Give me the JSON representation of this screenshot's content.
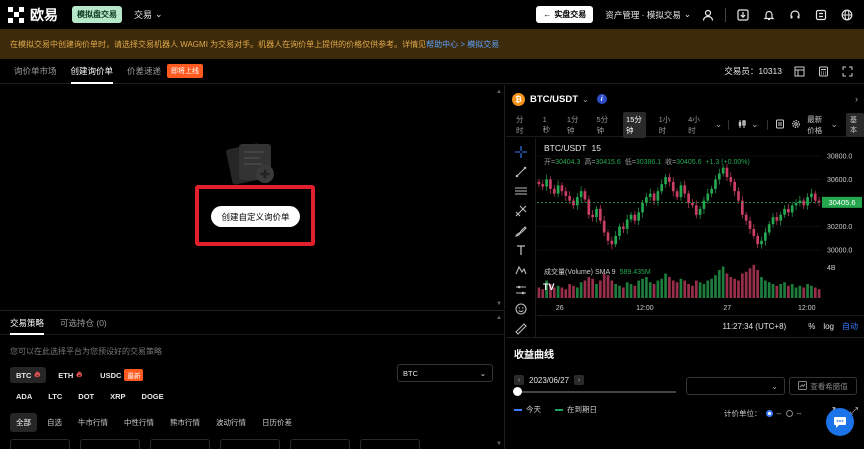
{
  "nav": {
    "logo_text": "欧易",
    "demo_badge": "模拟盘交易",
    "trade_menu": "交易",
    "real_trade_button": "实盘交易",
    "asset_menu": "资产管理 · 模拟交易"
  },
  "banner": {
    "text": "在模拟交易中创建询价单时，请选择交易机器人 WAGMI 为交易对手。机器人在询价单上提供的价格仅供参考。详情见",
    "link_text": "帮助中心 > 模拟交易"
  },
  "subtabs": {
    "items": [
      {
        "label": "询价单市场",
        "active": false
      },
      {
        "label": "创建询价单",
        "active": true
      },
      {
        "label": "价差速递",
        "active": false
      }
    ],
    "soon_badge": "即将上线",
    "trader_label": "交易员：",
    "trader_id": "10313"
  },
  "main": {
    "create_button": "创建自定义询价单"
  },
  "strategy": {
    "tabs": [
      {
        "label": "交易策略",
        "active": true
      },
      {
        "label": "可选持仓 (0)",
        "active": false
      }
    ],
    "hint": "您可以在此选择平台为您预设好的交易策略",
    "coins_row1": [
      {
        "label": "BTC",
        "active": true,
        "hot": true
      },
      {
        "label": "ETH",
        "active": false,
        "hot": true
      },
      {
        "label": "USDC",
        "active": false,
        "hot": false,
        "badge": "最新"
      }
    ],
    "pair_select": "BTC",
    "coins_row2": [
      "ADA",
      "LTC",
      "DOT",
      "XRP",
      "DOGE"
    ],
    "filters": [
      {
        "label": "全部",
        "active": true
      },
      {
        "label": "自选",
        "active": false
      },
      {
        "label": "牛市行情",
        "active": false
      },
      {
        "label": "中性行情",
        "active": false
      },
      {
        "label": "熊市行情",
        "active": false
      },
      {
        "label": "波动行情",
        "active": false
      },
      {
        "label": "日历价差",
        "active": false
      }
    ]
  },
  "chart": {
    "pair": "BTC/USDT",
    "intervals": [
      {
        "label": "分时",
        "active": false
      },
      {
        "label": "1秒",
        "active": false
      },
      {
        "label": "1分钟",
        "active": false
      },
      {
        "label": "5分钟",
        "active": false
      },
      {
        "label": "15分钟",
        "active": true
      },
      {
        "label": "1小时",
        "active": false
      },
      {
        "label": "4小时",
        "active": false
      }
    ],
    "latest_price_label": "最新价格",
    "more_label": "基本",
    "footer_time": "11:27:34 (UTC+8)",
    "footer_opts": [
      {
        "label": "%",
        "active": false
      },
      {
        "label": "log",
        "active": false
      },
      {
        "label": "自动",
        "active": true
      }
    ]
  },
  "chart_data": {
    "type": "candlestick",
    "title": "BTC/USDT · 15",
    "ohlc_label": {
      "open_label": "开=",
      "open": "30404.3",
      "high_label": "高=",
      "high": "30415.6",
      "low_label": "低=",
      "low": "30386.1",
      "close_label": "收=",
      "close": "30405.6",
      "change": "+1.3 (+0.00%)"
    },
    "interval_label": "15",
    "current_price": "30405.6",
    "y_ticks": [
      "30800.0",
      "30600.0",
      "30400.0",
      "30200.0",
      "30000.0"
    ],
    "ylim": [
      29950,
      30850
    ],
    "x_ticks": [
      "26",
      "12:00",
      "27",
      "12:00"
    ],
    "volume_label": "成交量(Volume) SMA 9",
    "volume_sma": "589.435M",
    "volume_tick": "4B",
    "closes": [
      30560,
      30540,
      30600,
      30520,
      30480,
      30550,
      30500,
      30460,
      30420,
      30380,
      30450,
      30500,
      30430,
      30300,
      30280,
      30350,
      30250,
      30150,
      30080,
      30050,
      30120,
      30200,
      30180,
      30260,
      30300,
      30250,
      30320,
      30400,
      30450,
      30480,
      30420,
      30500,
      30560,
      30620,
      30580,
      30500,
      30450,
      30550,
      30480,
      30400,
      30380,
      30300,
      30350,
      30420,
      30480,
      30520,
      30600,
      30650,
      30700,
      30620,
      30580,
      30500,
      30420,
      30300,
      30250,
      30180,
      30120,
      30050,
      30080,
      30150,
      30220,
      30280,
      30250,
      30300,
      30350,
      30320,
      30380,
      30400,
      30420,
      30380,
      30450,
      30480,
      30420,
      30405.6
    ],
    "volumes": [
      0.3,
      0.25,
      0.5,
      0.4,
      0.3,
      0.35,
      0.3,
      0.25,
      0.4,
      0.35,
      0.3,
      0.45,
      0.5,
      0.6,
      0.55,
      0.4,
      0.5,
      0.7,
      0.65,
      0.5,
      0.4,
      0.35,
      0.3,
      0.45,
      0.4,
      0.35,
      0.5,
      0.55,
      0.6,
      0.45,
      0.4,
      0.5,
      0.55,
      0.7,
      0.6,
      0.5,
      0.45,
      0.55,
      0.5,
      0.4,
      0.35,
      0.5,
      0.45,
      0.4,
      0.5,
      0.55,
      0.65,
      0.8,
      0.9,
      0.7,
      0.6,
      0.55,
      0.5,
      0.7,
      0.75,
      0.85,
      0.95,
      0.8,
      0.6,
      0.5,
      0.45,
      0.4,
      0.35,
      0.4,
      0.45,
      0.35,
      0.4,
      0.3,
      0.35,
      0.3,
      0.4,
      0.35,
      0.3,
      0.25
    ]
  },
  "profit": {
    "title": "收益曲线",
    "date": "2023/06/27",
    "view_button": "查看希腊值",
    "legend_today": "今天",
    "legend_expiry": "在到期日",
    "unit_label": "计价单位：",
    "unit_option1": "--",
    "unit_option2": "--"
  },
  "colors": {
    "up": "#25a750",
    "down": "#ca3f64",
    "accent": "#3b7bff",
    "banner_bg": "#3d2a0a",
    "banner_text": "#e0a94a",
    "highlight_box": "#e0202c"
  }
}
